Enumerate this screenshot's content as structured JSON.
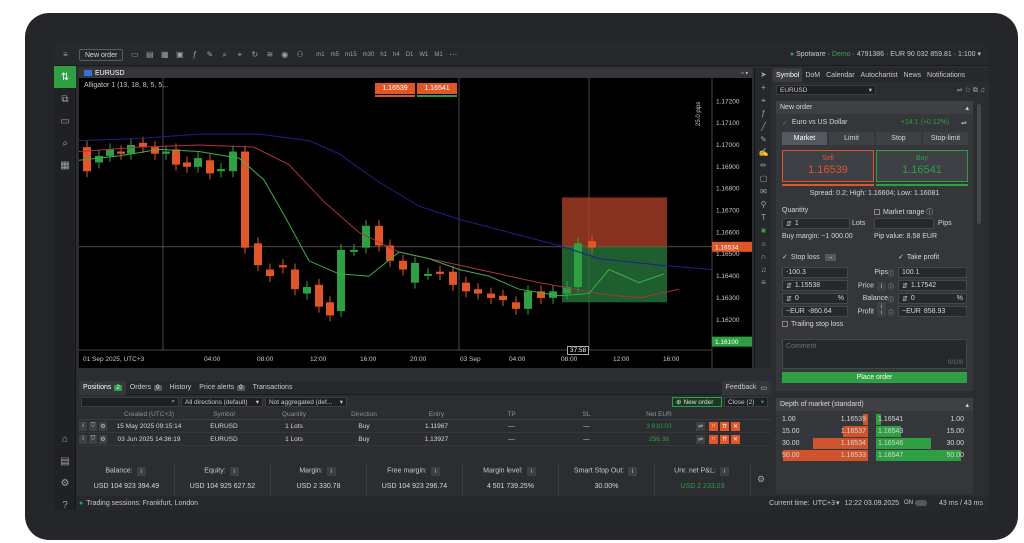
{
  "topbar": {
    "new_order": "New order",
    "timeframes": [
      "m1",
      "m5",
      "m15",
      "m30",
      "h1",
      "h4",
      "D1",
      "W1",
      "M1"
    ],
    "account_prefix": "Spotware",
    "account_demo": "Demo",
    "account_rest": "4791386 · EUR 90 032 859.81 · 1:100"
  },
  "chart": {
    "symbol": "EURUSD",
    "indicator": "Alligator 1 (13, 18, 8, 5, 5...",
    "sell_price": "1.16539",
    "buy_price": "1.16541",
    "pips_label": "25.0 pips",
    "crosshair_time": "37:58",
    "price_labels": [
      "1.17200",
      "1.17100",
      "1.17000",
      "1.16900",
      "1.16800",
      "1.16700",
      "1.16600",
      "1.16500",
      "1.16400",
      "1.16300",
      "1.16200"
    ],
    "current_price": "1.16534",
    "current_price_green": "1.16100",
    "time_labels": [
      "01 Sep 2025, UTC+3",
      "04:00",
      "08:00",
      "12:00",
      "16:00",
      "20:00",
      "03 Sep",
      "04:00",
      "08:00",
      "12:00",
      "16:00"
    ]
  },
  "bottom": {
    "tabs": [
      {
        "label": "Positions",
        "badge": "2"
      },
      {
        "label": "Orders",
        "badge": "0"
      },
      {
        "label": "History",
        "badge": ""
      },
      {
        "label": "Price alerts",
        "badge": "0"
      },
      {
        "label": "Transactions",
        "badge": ""
      }
    ],
    "feedback": "Feedback",
    "filter_direction": "All directions (default)",
    "filter_aggregation": "Not aggregated (def...",
    "new_order_btn": "New order",
    "close_btn": "Close (2)",
    "columns": [
      "Created (UTC+3)",
      "Symbol",
      "Quantity",
      "Direction",
      "Entry",
      "TP",
      "SL",
      "Net EUR"
    ],
    "rows": [
      {
        "created": "15 May 2025 09:15:14",
        "symbol": "EURUSD",
        "quantity": "1 Lots",
        "direction": "Buy",
        "entry": "1.11967",
        "tp": "—",
        "sl": "—",
        "net": "3 610.03"
      },
      {
        "created": "03 Jun 2025 14:36:19",
        "symbol": "EURUSD",
        "quantity": "1 Lots",
        "direction": "Buy",
        "entry": "1.13927",
        "tp": "—",
        "sl": "—",
        "net": "256.38"
      }
    ],
    "stats": [
      {
        "label": "Balance:",
        "value": "USD 104 923 394.49"
      },
      {
        "label": "Equity:",
        "value": "USD 104 925 627.52"
      },
      {
        "label": "Margin:",
        "value": "USD 2 330.78"
      },
      {
        "label": "Free margin:",
        "value": "USD 104 923 296.74"
      },
      {
        "label": "Margin level:",
        "value": "4 501 739.25%"
      },
      {
        "label": "Smart Stop Out:",
        "value": "30.00%"
      },
      {
        "label": "Unr. net P&L:",
        "value": "USD 2 233.03"
      }
    ]
  },
  "status": {
    "sessions": "Trading sessions: Frankfurt, London",
    "current_time_label": "Current time:",
    "tz": "UTC+3",
    "time": "12:22 03.09.2025",
    "toggle": "ON",
    "latency": "43 ms / 43 ms"
  },
  "right": {
    "tabs": [
      "Symbol",
      "DoM",
      "Calendar",
      "Autochartist",
      "News",
      "Notifications"
    ],
    "symbol_select": "EURUSD",
    "new_order": "New order",
    "instrument": "Euro vs US Dollar",
    "change": "+14.1 (+0.12%)",
    "order_types": [
      "Market",
      "Limit",
      "Stop",
      "Stop-limit"
    ],
    "sell_label": "Sell",
    "sell_price": "1.16539",
    "buy_label": "Buy",
    "buy_price": "1.16541",
    "spread": "Spread: 0.2; High: 1.16604; Low: 1.16081",
    "quantity_label": "Quantity",
    "market_range_label": "Market range",
    "quantity_value": "1",
    "lots": "Lots",
    "pips": "Pips",
    "buy_margin": "Buy margin: ~1 000.00",
    "pip_value": "Pip value: 8.58 EUR",
    "stop_loss": "Stop loss",
    "take_profit": "Take profit",
    "sl_pips": "-100.3",
    "tp_pips": "100.1",
    "sl_price": "1.15538",
    "tp_price": "1.17542",
    "sl_pct": "0",
    "tp_pct": "0",
    "row_labels": [
      "Pips",
      "Price",
      "Balance",
      "Profit"
    ],
    "sl_profit": "-860.64",
    "tp_profit": "858.93",
    "eur": "~EUR",
    "pct": "%",
    "trailing": "Trailing stop loss",
    "comment_placeholder": "Comment",
    "comment_count": "0/100",
    "place_order": "Place order",
    "dom_title": "Depth of market (standard)",
    "dom_sell": [
      {
        "vol": "1.00",
        "price": "1.16539"
      },
      {
        "vol": "15.00",
        "price": "1.16537"
      },
      {
        "vol": "30.00",
        "price": "1.16534"
      },
      {
        "vol": "50.00",
        "price": "1.16533"
      }
    ],
    "dom_buy": [
      {
        "price": "1.16541",
        "vol": "1.00"
      },
      {
        "price": "1.16543",
        "vol": "15.00"
      },
      {
        "price": "1.16546",
        "vol": "30.00"
      },
      {
        "price": "1.16547",
        "vol": "50.00"
      }
    ]
  },
  "colors": {
    "green": "#2ea043",
    "red": "#e0562b",
    "blue": "#1f1f8a"
  }
}
